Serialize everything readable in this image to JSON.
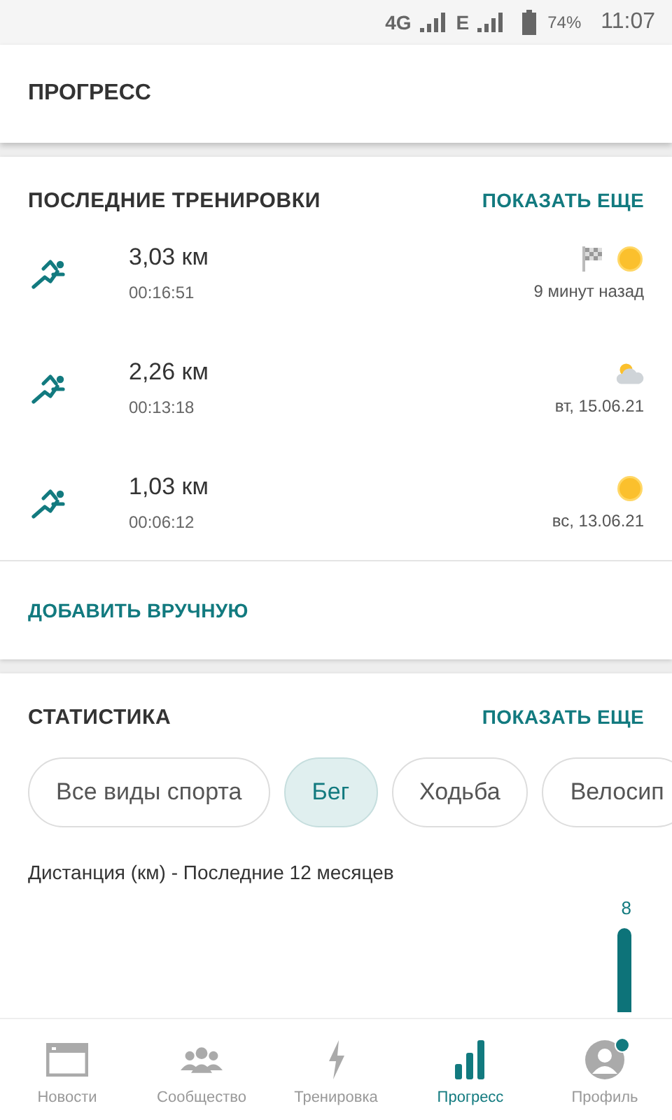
{
  "status_bar": {
    "network": "4G",
    "network_2": "E",
    "battery": "74%",
    "time": "11:07"
  },
  "header": {
    "title": "ПРОГРЕСС"
  },
  "recent": {
    "title": "ПОСЛЕДНИЕ ТРЕНИРОВКИ",
    "more": "ПОКАЗАТЬ ЕЩЕ",
    "workouts": [
      {
        "distance": "3,03 км",
        "duration": "00:16:51",
        "when": "9 минут назад",
        "flag": true,
        "kind": "sunny"
      },
      {
        "distance": "2,26 км",
        "duration": "00:13:18",
        "when": "вт, 15.06.21",
        "flag": false,
        "kind": "cloudy"
      },
      {
        "distance": "1,03 км",
        "duration": "00:06:12",
        "when": "вс, 13.06.21",
        "flag": false,
        "kind": "sunny"
      }
    ],
    "add": "ДОБАВИТЬ ВРУЧНУЮ"
  },
  "stats": {
    "title": "СТАТИСТИКА",
    "more": "ПОКАЗАТЬ ЕЩЕ",
    "filters": [
      {
        "label": "Все виды спорта",
        "selected": false
      },
      {
        "label": "Бег",
        "selected": true
      },
      {
        "label": "Ходьба",
        "selected": false
      },
      {
        "label": "Велосип",
        "selected": false
      }
    ],
    "chart_title": "Дистанция (км) - Последние 12 месяцев",
    "bar_label": "8"
  },
  "nav": [
    {
      "label": "Новости",
      "selected": false,
      "badge": false
    },
    {
      "label": "Сообщество",
      "selected": false,
      "badge": false
    },
    {
      "label": "Тренировка",
      "selected": false,
      "badge": false
    },
    {
      "label": "Прогресс",
      "selected": true,
      "badge": false
    },
    {
      "label": "Профиль",
      "selected": false,
      "badge": true
    }
  ]
}
